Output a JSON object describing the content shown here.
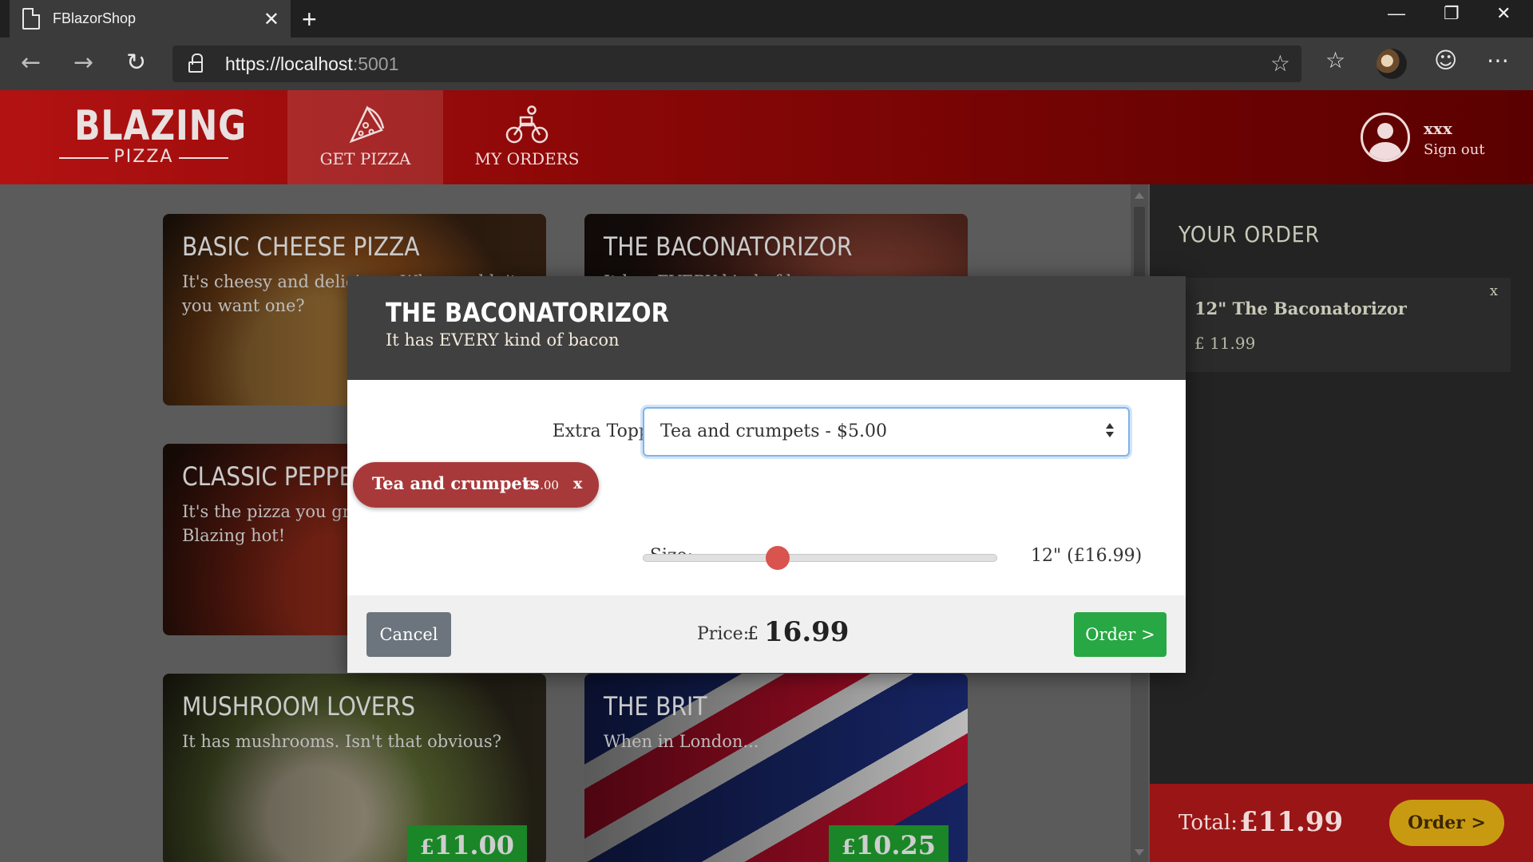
{
  "browser": {
    "tab_title": "FBlazorShop",
    "url_scheme": "https://",
    "url_host": "localhost",
    "url_port": ":5001"
  },
  "header": {
    "logo_big": "BLAZING",
    "logo_small": "PIZZA",
    "nav": [
      {
        "label": "GET PIZZA",
        "icon": "pizza-slice-icon",
        "active": true
      },
      {
        "label": "MY ORDERS",
        "icon": "motorbike-icon",
        "active": false
      }
    ],
    "user_name": "xxx",
    "sign_out": "Sign out"
  },
  "specials": [
    {
      "name": "BASIC CHEESE PIZZA",
      "description": "It's cheesy and delicious. Why wouldn't you want one?",
      "price": ""
    },
    {
      "name": "THE BACONATORIZOR",
      "description": "It has EVERY kind of bacon",
      "price": ""
    },
    {
      "name": "CLASSIC PEPPERONI",
      "description": "It's the pizza you grew up with, but Blazing hot!",
      "price": ""
    },
    {
      "name": "",
      "description": "",
      "price": ""
    },
    {
      "name": "MUSHROOM LOVERS",
      "description": "It has mushrooms. Isn't that obvious?",
      "price_currency": "£",
      "price": "11.00"
    },
    {
      "name": "THE BRIT",
      "description": "When in London...",
      "price_currency": "£",
      "price": "10.25"
    }
  ],
  "sidebar": {
    "heading": "YOUR ORDER",
    "items": [
      {
        "name": "12\" The Baconatorizor",
        "price": "£ 11.99",
        "remove": "x"
      }
    ],
    "total_label": "Total:",
    "total_value": "£11.99",
    "order_button": "Order >"
  },
  "dialog": {
    "title": "THE BACONATORIZOR",
    "subtitle": "It has EVERY kind of bacon",
    "toppings_label": "Extra Toppings:",
    "toppings_selected": "Tea and crumpets - $5.00",
    "chip_name": "Tea and crumpets",
    "chip_price": "£5.00",
    "chip_remove": "x",
    "size_label": "Size:",
    "size_value": "12\" (£16.99)",
    "size_fraction": 0.38,
    "cancel_button": "Cancel",
    "price_label": "Price:",
    "price_currency": "£",
    "price_value": "16.99",
    "order_button": "Order >"
  },
  "colors": {
    "brand_red": "#9a1515",
    "order_yellow": "#c89a12",
    "order_green": "#28a745",
    "chip_red": "#a8393a",
    "slider_knob": "#d9534f"
  }
}
